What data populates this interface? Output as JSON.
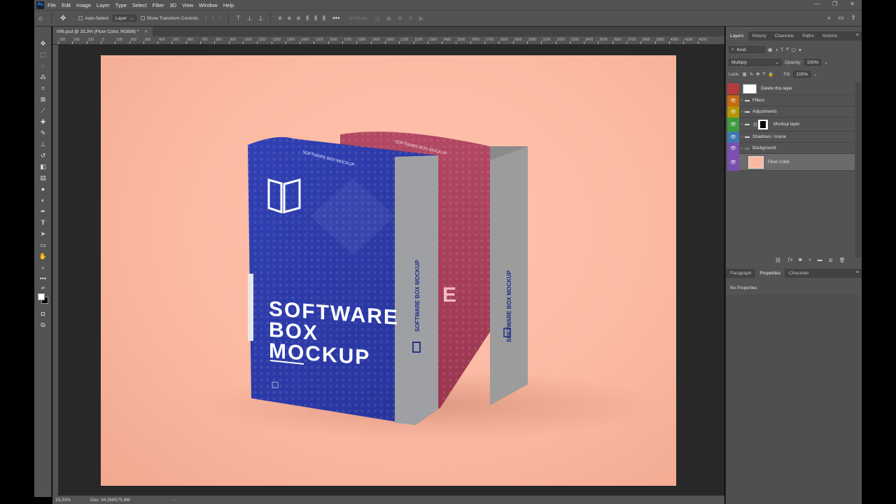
{
  "app": {
    "logo": "Ps",
    "menu": [
      "File",
      "Edit",
      "Image",
      "Layer",
      "Type",
      "Select",
      "Filter",
      "3D",
      "View",
      "Window",
      "Help"
    ],
    "window_controls": [
      "—",
      "❐",
      "✕"
    ]
  },
  "options": {
    "auto_select_label": "Auto-Select",
    "auto_select_target": "Layer",
    "transform_label": "Show Transform Controls",
    "mode_3d": "3D Mode:",
    "more": "•••"
  },
  "document": {
    "tab_title": "006.psd @ 33,3% (Floor Color, RGB/8) *",
    "tab_close": "✕",
    "zoom": "33,33%",
    "doc_info": "Doc: 34,3M/575,8M"
  },
  "ruler": {
    "top_labels": [
      "300",
      "200",
      "100",
      "0",
      "100",
      "200",
      "300",
      "400",
      "500",
      "600",
      "700",
      "800",
      "900",
      "1000",
      "1100",
      "1200",
      "1300",
      "1400",
      "1500",
      "1600",
      "1700",
      "1800",
      "1900",
      "2000",
      "2100",
      "2200",
      "2300",
      "2400",
      "2500",
      "2600",
      "2700",
      "2800",
      "2900",
      "3000",
      "3100",
      "3200",
      "3300",
      "3400",
      "3500",
      "3600",
      "3700",
      "3800",
      "3900",
      "4000",
      "4100",
      "4200"
    ]
  },
  "artwork": {
    "front_box": {
      "top_text": "SOFTWARE BOX MOCKUP",
      "title_lines": [
        "SOFTWARE",
        "BOX",
        "MOCKUP"
      ],
      "side_text": "SOFTWARE BOX MOCKUP",
      "color_face": "#2c3aa6",
      "color_side": "#9a9a9a"
    },
    "back_box": {
      "top_text": "SOFTWARE BOX MOCKUP",
      "visible_letter": "E",
      "side_text": "SOFTWARE BOX MOCKUP",
      "color_face": "#a33b52"
    }
  },
  "panels": {
    "top_tabs": [
      "Layers",
      "History",
      "Channels",
      "Paths",
      "Actions"
    ],
    "kind_label": "Kind",
    "blend_mode": "Multiply",
    "opacity_label": "Opacity:",
    "opacity_value": "100%",
    "lock_label": "Lock:",
    "fill_label": "Fill:",
    "fill_value": "100%",
    "layers": [
      {
        "name": "Delete this layer",
        "color": "#b43b3b",
        "visible": false,
        "type": "layer"
      },
      {
        "name": "Filters",
        "color": "#c46a0b",
        "visible": true,
        "type": "group"
      },
      {
        "name": "Adjustments",
        "color": "#b59400",
        "visible": true,
        "type": "group"
      },
      {
        "name": "Mockup layer",
        "color": "#3f9a3f",
        "visible": true,
        "type": "group-mask"
      },
      {
        "name": "Shadows / scene",
        "color": "#3f78b0",
        "visible": true,
        "type": "group"
      },
      {
        "name": "Background",
        "color": "#7a4fb0",
        "visible": true,
        "type": "group-open"
      },
      {
        "name": "Floor Color",
        "color": "#7a4fb0",
        "visible": true,
        "type": "fill"
      }
    ],
    "bottom_tabs": [
      "Paragraph",
      "Properties",
      "Character"
    ],
    "properties_text": "No Properties"
  }
}
